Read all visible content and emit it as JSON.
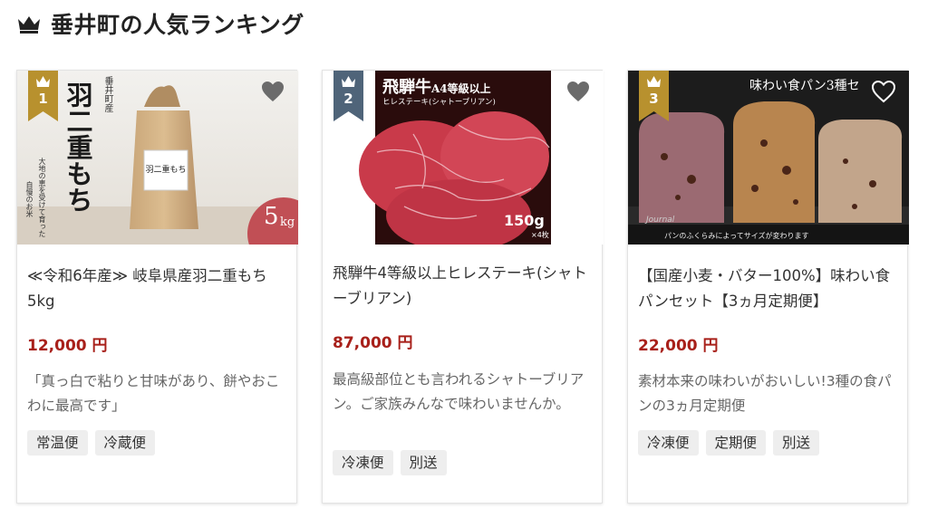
{
  "header": {
    "title": "垂井町の人気ランキング",
    "icon": "crown-icon"
  },
  "colors": {
    "price": "#a8201a",
    "rank1": "#b8912e",
    "rank2": "#4f6479",
    "rank3": "#b8912e"
  },
  "items": [
    {
      "rank": "1",
      "title": "≪令和6年産≫ 岐阜県産羽二重もち5kg",
      "price": "12,000 円",
      "description": "「真っ白で粘りと甘味があり、餅やおこわに最高です」",
      "tags": [
        "常温便",
        "冷蔵便"
      ],
      "image": {
        "calligraphy": "羽二重もち",
        "sub_vertical_1": "垂井町産",
        "sub_vertical_2": "大地の恵を受けて育った",
        "sub_vertical_3": "自慢のお米",
        "bag_label": "羽二重もち",
        "weight_num": "5",
        "weight_unit": "kg"
      }
    },
    {
      "rank": "2",
      "title": "飛騨牛4等級以上ヒレステーキ(シャトーブリアン)",
      "price": "87,000 円",
      "description": "最高級部位とも言われるシャトーブリアン。ご家族みんなで味わいませんか。",
      "tags": [
        "冷凍便",
        "別送"
      ],
      "image": {
        "headline": "飛騨牛",
        "headline_sub": "A4等級以上",
        "caption": "ヒレステーキ(シャトーブリアン)",
        "weight": "150g",
        "count": "×4枚"
      }
    },
    {
      "rank": "3",
      "title": "【国産小麦・バター100%】味わい食パンセット【3ヵ月定期便】",
      "price": "22,000 円",
      "description": "素材本来の味わいがおいしい!3種の食パンの3ヵ月定期便",
      "tags": [
        "冷凍便",
        "定期便",
        "別送"
      ],
      "image": {
        "headline": "味わい食パン3種セ",
        "footer": "パンのふくらみによってサイズが変わります",
        "board_text": "Journal"
      }
    }
  ]
}
